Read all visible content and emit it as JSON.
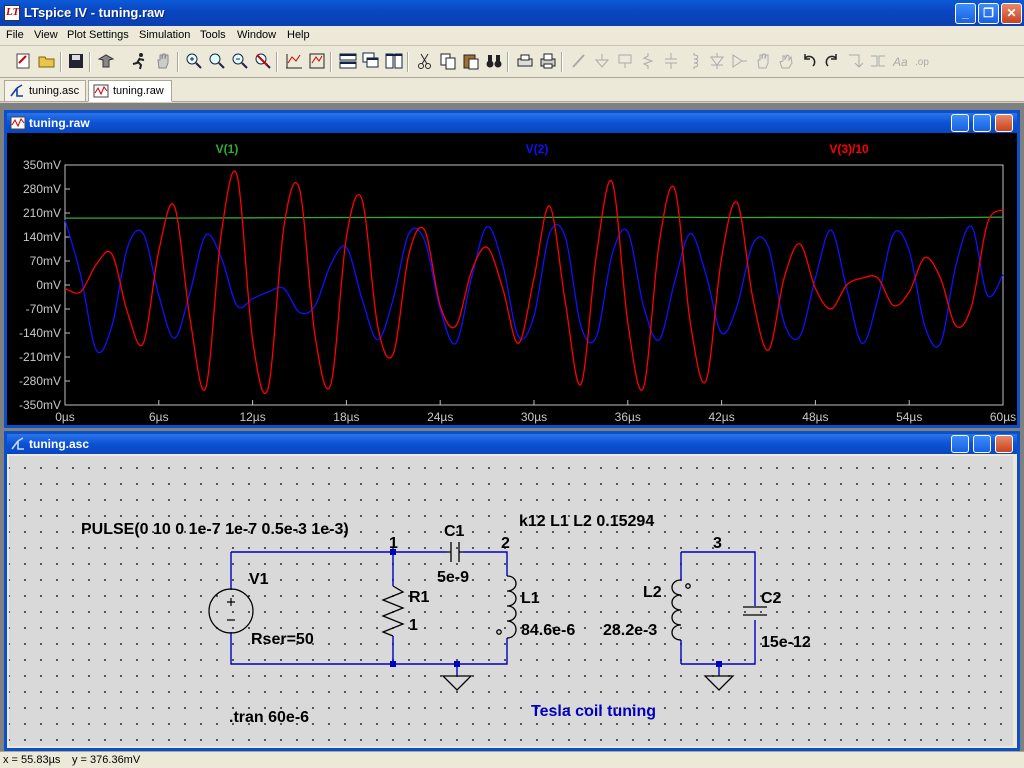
{
  "app": {
    "title": "LTspice IV - tuning.raw"
  },
  "menu": [
    "File",
    "View",
    "Plot Settings",
    "Simulation",
    "Tools",
    "Window",
    "Help"
  ],
  "tabs": [
    {
      "label": "tuning.asc",
      "active": false
    },
    {
      "label": "tuning.raw",
      "active": true
    }
  ],
  "plot_window": {
    "title": "tuning.raw"
  },
  "schematic_window": {
    "title": "tuning.asc"
  },
  "chart_data": {
    "type": "line",
    "xlabel": "",
    "ylabel": "",
    "xlim": [
      0,
      60
    ],
    "ylim": [
      -350,
      350
    ],
    "x_ticks": [
      "0µs",
      "6µs",
      "12µs",
      "18µs",
      "24µs",
      "30µs",
      "36µs",
      "42µs",
      "48µs",
      "54µs",
      "60µs"
    ],
    "y_ticks": [
      "350mV",
      "280mV",
      "210mV",
      "140mV",
      "70mV",
      "0mV",
      "-70mV",
      "-140mV",
      "-210mV",
      "-280mV",
      "-350mV"
    ],
    "grid": false,
    "series": [
      {
        "name": "V(1)",
        "color": "#33aa33",
        "x": [
          0,
          6,
          12,
          18,
          24,
          30,
          36,
          42,
          48,
          54,
          60
        ],
        "values": [
          195,
          195,
          196,
          197,
          197,
          197,
          198,
          197,
          197,
          196,
          198
        ]
      },
      {
        "name": "V(2)",
        "color": "#1010ff",
        "x": [
          0,
          1,
          2,
          3,
          4,
          5,
          6,
          7,
          8,
          9,
          10,
          11,
          12,
          13,
          14,
          15,
          16,
          17,
          18,
          19,
          20,
          21,
          22,
          23,
          24,
          25,
          26,
          27,
          28,
          29,
          30,
          31,
          32,
          33,
          34,
          35,
          36,
          37,
          38,
          39,
          40,
          41,
          42,
          43,
          44,
          45,
          46,
          47,
          48,
          49,
          50,
          51,
          52,
          53,
          54,
          55,
          56,
          57,
          58,
          59,
          60
        ],
        "values": [
          190,
          30,
          -190,
          -120,
          110,
          150,
          -30,
          -155,
          -20,
          145,
          80,
          -60,
          -40,
          -20,
          -10,
          -80,
          -60,
          60,
          110,
          -40,
          -160,
          -40,
          150,
          130,
          -70,
          -170,
          20,
          170,
          60,
          -150,
          -90,
          150,
          140,
          -120,
          -150,
          90,
          155,
          -60,
          -160,
          10,
          150,
          30,
          -140,
          -60,
          120,
          110,
          -110,
          -150,
          20,
          160,
          -10,
          -170,
          -40,
          150,
          100,
          -120,
          -170,
          60,
          170,
          -30,
          30
        ]
      },
      {
        "name": "V(3)/10",
        "color": "#ff0000",
        "x": [
          0,
          1,
          2,
          3,
          4,
          5,
          6,
          7,
          8,
          9,
          10,
          11,
          12,
          13,
          14,
          15,
          16,
          17,
          18,
          19,
          20,
          21,
          22,
          23,
          24,
          25,
          26,
          27,
          28,
          29,
          30,
          31,
          32,
          33,
          34,
          35,
          36,
          37,
          38,
          39,
          40,
          41,
          42,
          43,
          44,
          45,
          46,
          47,
          48,
          49,
          50,
          51,
          52,
          53,
          54,
          55,
          56,
          57,
          58,
          59,
          60
        ],
        "values": [
          -10,
          -20,
          60,
          90,
          -80,
          -170,
          100,
          230,
          -100,
          -300,
          150,
          320,
          -160,
          -300,
          170,
          280,
          -150,
          -290,
          140,
          250,
          -120,
          -200,
          90,
          160,
          -60,
          -120,
          40,
          110,
          -10,
          -170,
          20,
          230,
          -50,
          -290,
          90,
          300,
          -110,
          -300,
          120,
          280,
          -110,
          -280,
          80,
          240,
          -40,
          -190,
          20,
          120,
          -10,
          -70,
          0,
          20,
          20,
          -60,
          -20,
          80,
          20,
          -120,
          -60,
          180,
          220
        ]
      }
    ]
  },
  "schematic": {
    "pulse_label": "PULSE(0 10 0 1e-7 1e-7 0.5e-3 1e-3)",
    "coupling_label": "k12 L1 L2 0.15294",
    "v1_name": "V1",
    "rser": "Rser=50",
    "r1_name": "R1",
    "r1_value": "1",
    "c1_name": "C1",
    "c1_value": "5e-9",
    "l1_name": "L1",
    "l1_value": "84.6e-6",
    "l2_name": "L2",
    "l2_value": "28.2e-3",
    "c2_name": "C2",
    "c2_value": "15e-12",
    "node1": "1",
    "node2": "2",
    "node3": "3",
    "tran": ".tran 60e-6",
    "comment": "Tesla coil tuning"
  },
  "status": {
    "x": "x = 55.83µs",
    "y": "y = 376.36mV"
  }
}
